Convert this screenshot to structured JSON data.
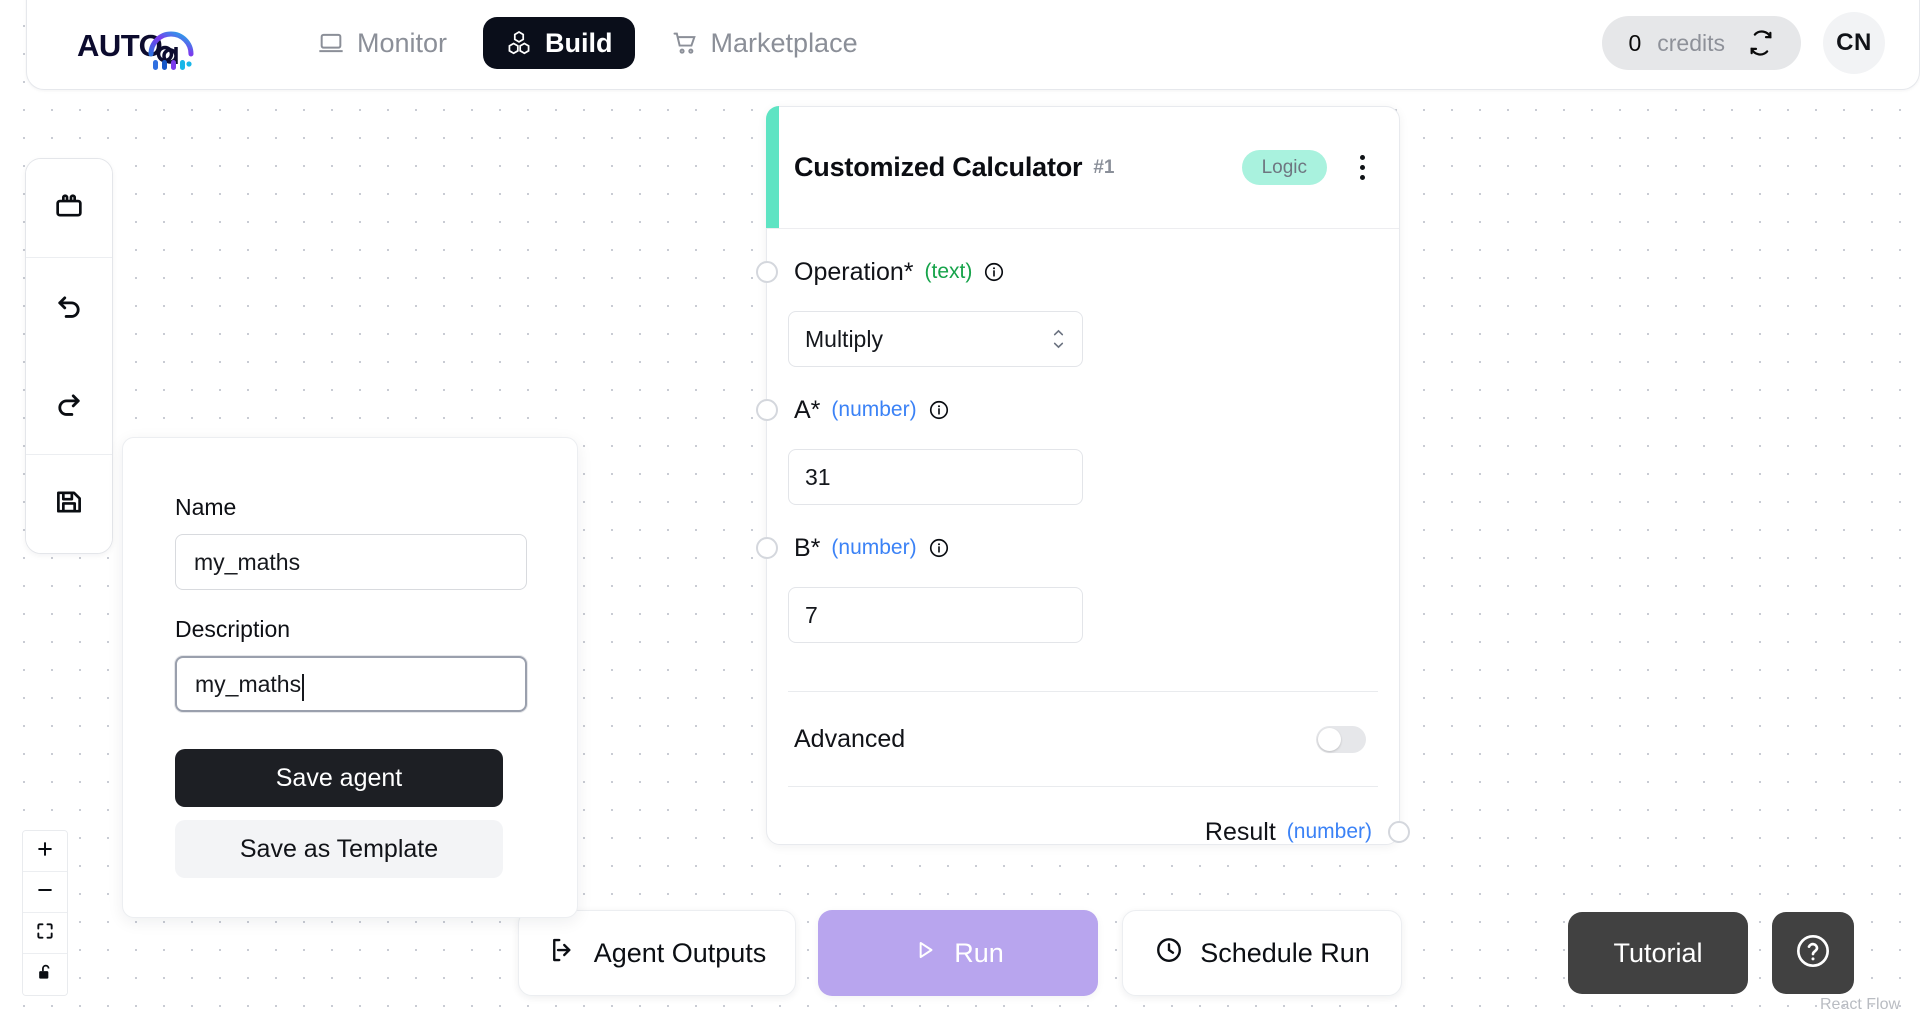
{
  "app": {
    "brand": "AUTOGPT",
    "logo_icon": "autogpt-logo"
  },
  "navbar": {
    "tabs": [
      {
        "label": "Monitor",
        "icon": "monitor-laptop-icon",
        "active": false
      },
      {
        "label": "Build",
        "icon": "blocks-cubes-icon",
        "active": true
      },
      {
        "label": "Marketplace",
        "icon": "shopping-cart-icon",
        "active": false
      }
    ],
    "credits": {
      "amount": "0",
      "label": "credits",
      "refresh_icon": "refresh-icon"
    },
    "avatar": {
      "initials": "CN"
    }
  },
  "left_toolbar": {
    "buttons": [
      {
        "name": "blocks-button",
        "icon": "blocks-icon"
      },
      {
        "name": "undo-button",
        "icon": "undo-arrow-icon"
      },
      {
        "name": "redo-button",
        "icon": "redo-arrow-icon"
      },
      {
        "name": "save-button",
        "icon": "floppy-disk-icon"
      }
    ]
  },
  "zoom_controls": {
    "buttons": [
      {
        "name": "zoom-in-button",
        "icon": "plus-icon"
      },
      {
        "name": "zoom-out-button",
        "icon": "minus-icon"
      },
      {
        "name": "fit-view-button",
        "icon": "fit-view-icon"
      },
      {
        "name": "lock-button",
        "icon": "unlocked-padlock-icon"
      }
    ]
  },
  "save_panel": {
    "name_label": "Name",
    "name_value": "my_maths",
    "description_label": "Description",
    "description_value": "my_maths",
    "save_agent_label": "Save agent",
    "save_template_label": "Save as Template"
  },
  "node": {
    "title": "Customized Calculator",
    "number": "#1",
    "category_badge": "Logic",
    "accent_color": "#5ee4c3",
    "badge_color": "#a9f2de",
    "menu_icon": "kebab-menu-icon",
    "inputs": [
      {
        "label": "Operation*",
        "type": "(text)",
        "type_kind": "text",
        "control": "select",
        "value": "Multiply"
      },
      {
        "label": "A*",
        "type": "(number)",
        "type_kind": "number",
        "control": "input",
        "value": "31"
      },
      {
        "label": "B*",
        "type": "(number)",
        "type_kind": "number",
        "control": "input",
        "value": "7"
      }
    ],
    "advanced": {
      "label": "Advanced",
      "enabled": false
    },
    "output": {
      "label": "Result",
      "type": "(number)"
    }
  },
  "bottom_bar": {
    "agent_outputs": {
      "label": "Agent Outputs",
      "icon": "output-arrow-icon"
    },
    "run": {
      "label": "Run",
      "icon": "play-triangle-icon",
      "color": "#b8a5ee"
    },
    "schedule_run": {
      "label": "Schedule Run",
      "icon": "clock-icon"
    },
    "tutorial": {
      "label": "Tutorial"
    },
    "help": {
      "icon": "question-circle-icon"
    },
    "attribution": "React Flow"
  }
}
